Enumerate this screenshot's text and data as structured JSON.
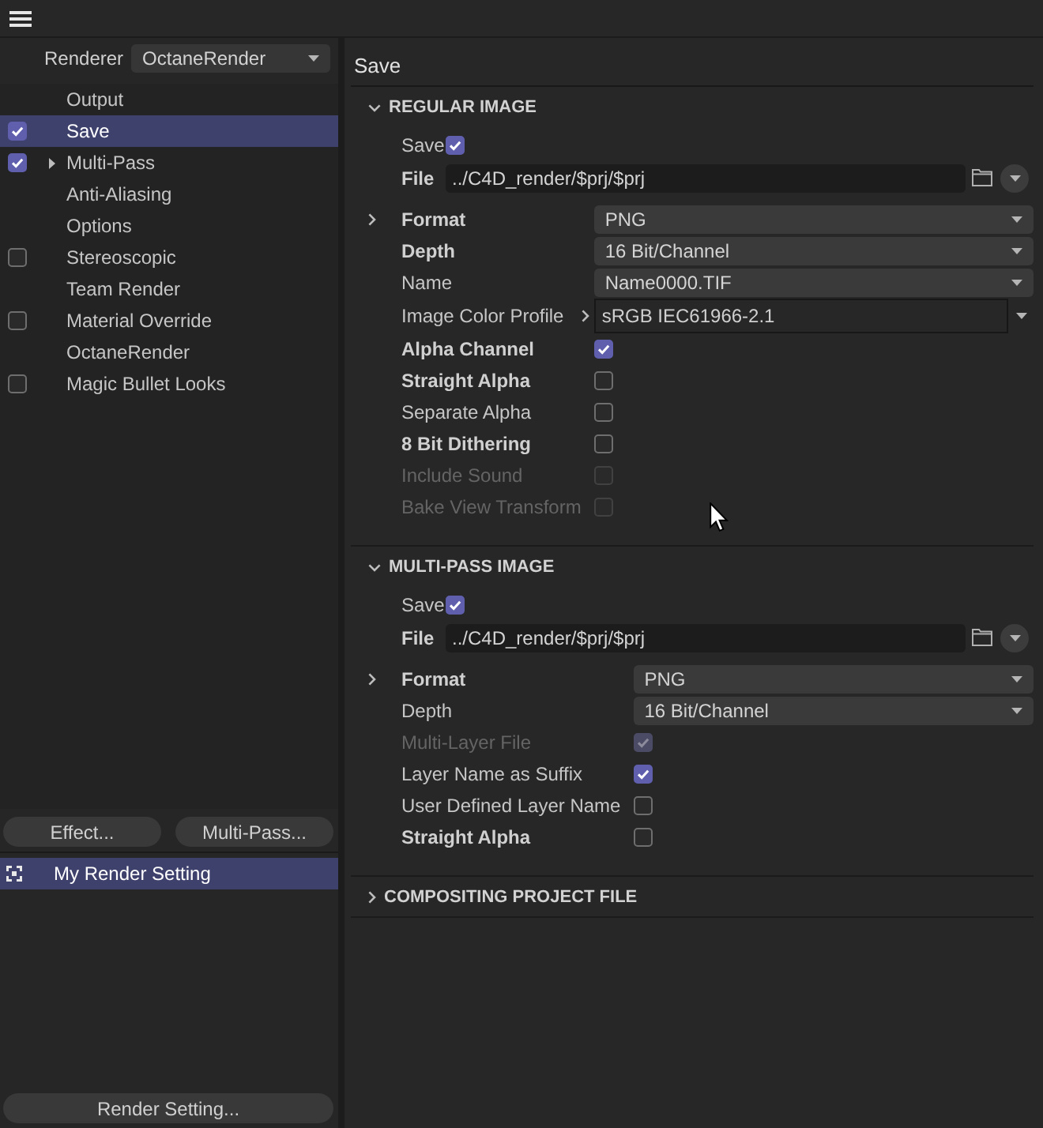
{
  "renderer": {
    "label": "Renderer",
    "value": "OctaneRender"
  },
  "settings_list": [
    {
      "label": "Output",
      "kind": "plain",
      "selected": false
    },
    {
      "label": "Save",
      "kind": "toggle",
      "checked": true,
      "selected": true
    },
    {
      "label": "Multi-Pass",
      "kind": "toggle",
      "checked": true,
      "expanded": false,
      "selected": false
    },
    {
      "label": "Anti-Aliasing",
      "kind": "plain",
      "selected": false
    },
    {
      "label": "Options",
      "kind": "plain",
      "selected": false
    },
    {
      "label": "Stereoscopic",
      "kind": "toggle",
      "checked": false,
      "selected": false
    },
    {
      "label": "Team Render",
      "kind": "plain",
      "selected": false
    },
    {
      "label": "Material Override",
      "kind": "toggle",
      "checked": false,
      "selected": false
    },
    {
      "label": "OctaneRender",
      "kind": "plain",
      "selected": false
    },
    {
      "label": "Magic Bullet Looks",
      "kind": "toggle",
      "checked": false,
      "selected": false
    }
  ],
  "list_buttons": [
    {
      "label": "Effect..."
    },
    {
      "label": "Multi-Pass..."
    }
  ],
  "render_settings": [
    {
      "label": "My Render Setting",
      "selected": true
    }
  ],
  "footer_button": {
    "label": "Render Setting..."
  },
  "panel": {
    "title": "Save",
    "sections": [
      {
        "title": "REGULAR IMAGE",
        "expanded": true,
        "save": {
          "label": "Save",
          "bold": false,
          "checked": true
        },
        "file": {
          "label": "File",
          "bold": true,
          "value": "../C4D_render/$prj/$prj"
        },
        "rows": [
          {
            "kind": "dropdown",
            "label": "Format",
            "bold": true,
            "expanded": false,
            "value": "PNG"
          },
          {
            "kind": "dropdown",
            "label": "Depth",
            "bold": true,
            "value": "16 Bit/Channel"
          },
          {
            "kind": "dropdown",
            "label": "Name",
            "bold": false,
            "value": "Name0000.TIF"
          },
          {
            "kind": "profile",
            "label": "Image Color Profile",
            "bold": false,
            "expanded": false,
            "value": "sRGB IEC61966-2.1"
          },
          {
            "kind": "checkbox",
            "label": "Alpha Channel",
            "bold": true,
            "checked": true,
            "disabled": false
          },
          {
            "kind": "checkbox",
            "label": "Straight Alpha",
            "bold": true,
            "checked": false,
            "disabled": false
          },
          {
            "kind": "checkbox",
            "label": "Separate Alpha",
            "bold": false,
            "checked": false,
            "disabled": false
          },
          {
            "kind": "checkbox",
            "label": "8 Bit Dithering",
            "bold": true,
            "checked": false,
            "disabled": false
          },
          {
            "kind": "checkbox",
            "label": "Include Sound",
            "bold": false,
            "checked": false,
            "disabled": true
          },
          {
            "kind": "checkbox",
            "label": "Bake View Transform",
            "bold": false,
            "checked": false,
            "disabled": true
          }
        ]
      },
      {
        "title": "MULTI-PASS IMAGE",
        "expanded": true,
        "save": {
          "label": "Save",
          "bold": false,
          "checked": true
        },
        "file": {
          "label": "File",
          "bold": true,
          "value": "../C4D_render/$prj/$prj"
        },
        "rows": [
          {
            "kind": "dropdown",
            "label": "Format",
            "bold": true,
            "expanded": false,
            "value": "PNG"
          },
          {
            "kind": "dropdown",
            "label": "Depth",
            "bold": false,
            "value": "16 Bit/Channel"
          },
          {
            "kind": "checkbox",
            "label": "Multi-Layer File",
            "bold": false,
            "checked": true,
            "disabled": true
          },
          {
            "kind": "checkbox",
            "label": "Layer Name as Suffix",
            "bold": false,
            "checked": true,
            "disabled": false
          },
          {
            "kind": "checkbox",
            "label": "User Defined Layer Name",
            "bold": false,
            "checked": false,
            "disabled": false
          },
          {
            "kind": "checkbox",
            "label": "Straight Alpha",
            "bold": true,
            "checked": false,
            "disabled": false
          }
        ]
      },
      {
        "title": "COMPOSITING PROJECT FILE",
        "expanded": false
      }
    ]
  }
}
